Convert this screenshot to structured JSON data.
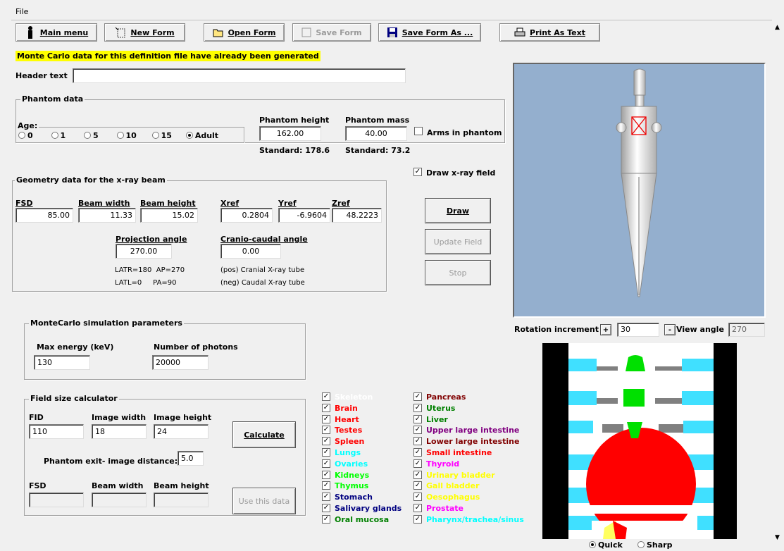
{
  "menu": {
    "file": "File"
  },
  "toolbar": {
    "main_menu": "Main menu",
    "new_form": "New Form",
    "open_form": "Open Form",
    "save_form": "Save Form",
    "save_form_as": "Save Form As ...",
    "print_as_text": "Print As Text"
  },
  "banner": "Monte Carlo data for this definition file have already been  generated",
  "header": {
    "label": "Header text",
    "value": ""
  },
  "phantom": {
    "group": "Phantom data",
    "age_label": "Age:",
    "ages": [
      "0",
      "1",
      "5",
      "10",
      "15",
      "Adult"
    ],
    "age_selected": "Adult",
    "height_label": "Phantom height",
    "height": "162.00",
    "mass_label": "Phantom mass",
    "mass": "40.00",
    "arms_label": "Arms in phantom",
    "std_height": "Standard: 178.6",
    "std_mass": "Standard: 73.2"
  },
  "draw_field": {
    "label": "Draw x-ray field",
    "checked": true
  },
  "geometry": {
    "group": "Geometry data for the x-ray beam",
    "fsd_label": "FSD",
    "fsd": "85.00",
    "bw_label": "Beam width",
    "bw": "11.33",
    "bh_label": "Beam height",
    "bh": "15.02",
    "xref_label": "Xref",
    "xref": "0.2804",
    "yref_label": "Yref",
    "yref": "-6.9604",
    "zref_label": "Zref",
    "zref": "48.2223",
    "proj_label": "Projection angle",
    "proj": "270.00",
    "cc_label": "Cranio-caudal angle",
    "cc": "0.00",
    "note1a": "LATR=180  AP=270",
    "note1b": "LATL=0     PA=90",
    "note2a": "(pos) Cranial X-ray tube",
    "note2b": "(neg) Caudal X-ray tube"
  },
  "buttons": {
    "draw": "Draw",
    "update": "Update Field",
    "stop": "Stop",
    "calculate": "Calculate",
    "use": "Use this data"
  },
  "montecarlo": {
    "group": "MonteCarlo simulation parameters",
    "energy_label": "Max energy (keV)",
    "energy": "130",
    "photons_label": "Number of photons",
    "photons": "20000"
  },
  "fieldcalc": {
    "group": "Field size calculator",
    "fid_label": "FID",
    "fid": "110",
    "iw_label": "Image width",
    "iw": "18",
    "ih_label": "Image height",
    "ih": "24",
    "exit_label": "Phantom exit- image distance:",
    "exit": "5.0",
    "fsd_label": "FSD",
    "bw_label": "Beam width",
    "bh_label": "Beam height"
  },
  "organs_left": [
    {
      "name": "Skeleton",
      "color": "#ffffff"
    },
    {
      "name": "Brain",
      "color": "#ff0000"
    },
    {
      "name": "Heart",
      "color": "#ff0000"
    },
    {
      "name": "Testes",
      "color": "#ff0000"
    },
    {
      "name": "Spleen",
      "color": "#ff0000"
    },
    {
      "name": "Lungs",
      "color": "#00ffff"
    },
    {
      "name": "Ovaries",
      "color": "#00ffff"
    },
    {
      "name": "Kidneys",
      "color": "#00ff00"
    },
    {
      "name": "Thymus",
      "color": "#00ff00"
    },
    {
      "name": "Stomach",
      "color": "#000080"
    },
    {
      "name": "Salivary glands",
      "color": "#000080"
    },
    {
      "name": "Oral mucosa",
      "color": "#008000"
    }
  ],
  "organs_right": [
    {
      "name": "Pancreas",
      "color": "#800000"
    },
    {
      "name": "Uterus",
      "color": "#008000"
    },
    {
      "name": "Liver",
      "color": "#008000"
    },
    {
      "name": "Upper large intestine",
      "color": "#800080"
    },
    {
      "name": "Lower large intestine",
      "color": "#800000"
    },
    {
      "name": "Small intestine",
      "color": "#ff0000"
    },
    {
      "name": "Thyroid",
      "color": "#ff00ff"
    },
    {
      "name": "Urinary bladder",
      "color": "#ffff00"
    },
    {
      "name": "Gall bladder",
      "color": "#ffff00"
    },
    {
      "name": "Oesophagus",
      "color": "#ffff00"
    },
    {
      "name": "Prostate",
      "color": "#ff00ff"
    },
    {
      "name": "Pharynx/trachea/sinus",
      "color": "#00ffff"
    }
  ],
  "view": {
    "rot_label": "Rotation increment",
    "plus": "+",
    "minus": "-",
    "rot": "30",
    "view_label": "View angle",
    "view": "270",
    "quick": "Quick",
    "sharp": "Sharp",
    "bg": "#94afce"
  }
}
